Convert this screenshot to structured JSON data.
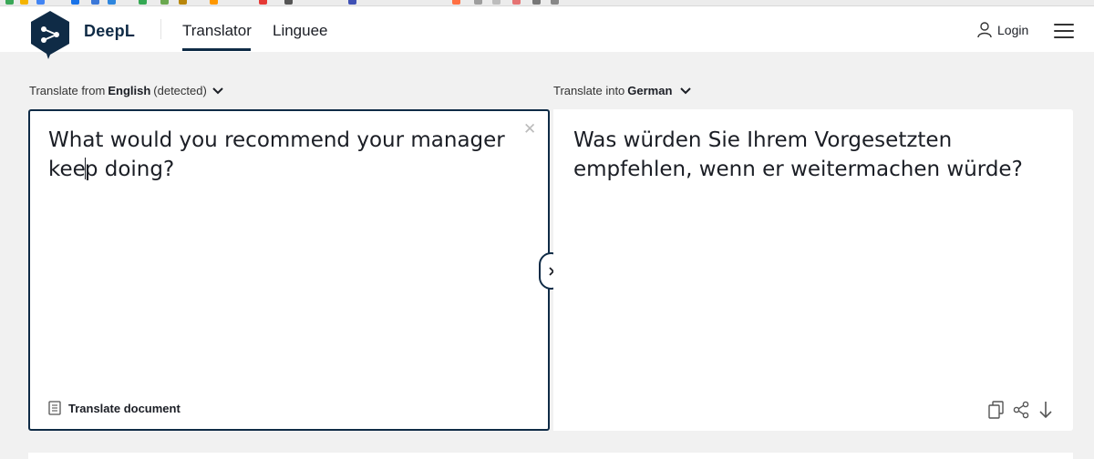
{
  "header": {
    "brand": "DeepL",
    "tabs": [
      {
        "label": "Translator",
        "active": true
      },
      {
        "label": "Linguee",
        "active": false
      }
    ],
    "login_label": "Login"
  },
  "source": {
    "label_prefix": "Translate from",
    "language": "English",
    "label_suffix": "(detected)",
    "text": "What would you recommend your manager keep doing?",
    "translate_document_label": "Translate document"
  },
  "target": {
    "label_prefix": "Translate into",
    "language": "German",
    "text": "Was würden Sie Ihrem Vorgesetzten empfehlen, wenn er weitermachen würde?"
  },
  "colors": {
    "accent": "#0f2b46",
    "background": "#f1f1f1",
    "panel": "#ffffff"
  },
  "icons": [
    "deepl-logo",
    "user-icon",
    "hamburger-menu-icon",
    "chevron-down-icon",
    "close-icon",
    "document-icon",
    "copy-icon",
    "share-icon",
    "download-icon",
    "chevron-right-icon"
  ]
}
